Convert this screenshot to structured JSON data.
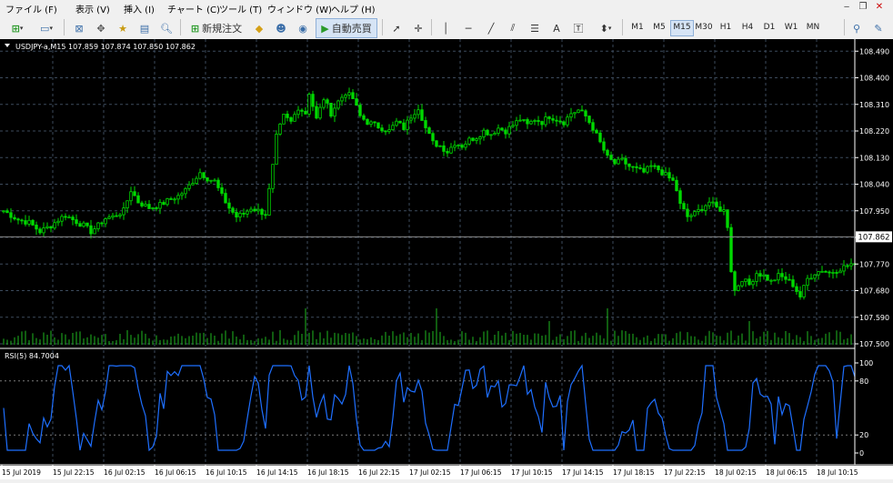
{
  "menu": {
    "items": [
      "ファイル (F)",
      "表示 (V)",
      "挿入 (I)",
      "チャート (C)",
      "ツール (T)",
      "ウィンドウ (W)",
      "ヘルプ (H)"
    ]
  },
  "toolbar": {
    "new_order_label": "新規注文",
    "auto_trade_label": "自動売買",
    "text_tool_label": "A",
    "timeframes": [
      "M1",
      "M5",
      "M15",
      "M30",
      "H1",
      "H4",
      "D1",
      "W1",
      "MN"
    ],
    "active_timeframe": "M15"
  },
  "colors": {
    "background": "#000000",
    "grid": "#3c4a5c",
    "candles": "#00d800",
    "volume": "#1fb81f",
    "rsi_line": "#1e6fff",
    "price_text": "#ffffff"
  },
  "chart_data": [
    {
      "type": "candlestick",
      "title": "USDJPY-a,M15  107.859 107.874 107.850 107.862",
      "current_price_label": "107.862",
      "current_price": 107.862,
      "ylim": [
        107.5,
        108.5
      ],
      "y_ticks": [
        "108.490",
        "108.400",
        "108.310",
        "108.220",
        "108.130",
        "108.040",
        "107.950",
        "107.860",
        "107.770",
        "107.680",
        "107.590",
        "107.500"
      ],
      "y_tick_values": [
        108.49,
        108.4,
        108.31,
        108.22,
        108.13,
        108.04,
        107.95,
        107.86,
        107.77,
        107.68,
        107.59,
        107.5
      ],
      "close_path": [
        [
          0,
          107.95
        ],
        [
          4,
          107.92
        ],
        [
          7,
          107.91
        ],
        [
          10,
          107.88
        ],
        [
          13,
          107.9
        ],
        [
          15,
          107.92
        ],
        [
          17,
          107.935
        ],
        [
          19,
          107.92
        ],
        [
          22,
          107.9
        ],
        [
          24,
          107.88
        ],
        [
          26,
          107.9
        ],
        [
          28,
          107.925
        ],
        [
          30,
          107.93
        ],
        [
          33,
          107.95
        ],
        [
          35,
          108.02
        ],
        [
          37,
          107.98
        ],
        [
          40,
          107.96
        ],
        [
          43,
          107.97
        ],
        [
          46,
          107.99
        ],
        [
          48,
          108.0
        ],
        [
          50,
          108.02
        ],
        [
          52,
          108.05
        ],
        [
          54,
          108.08
        ],
        [
          56,
          108.06
        ],
        [
          58,
          108.05
        ],
        [
          60,
          108.0
        ],
        [
          62,
          107.96
        ],
        [
          64,
          107.93
        ],
        [
          66,
          107.94
        ],
        [
          68,
          107.96
        ],
        [
          70,
          107.95
        ],
        [
          72,
          107.94
        ],
        [
          74,
          108.1
        ],
        [
          75,
          108.2
        ],
        [
          77,
          108.27
        ],
        [
          79,
          108.25
        ],
        [
          81,
          108.3
        ],
        [
          83,
          108.28
        ],
        [
          84,
          108.35
        ],
        [
          86,
          108.26
        ],
        [
          88,
          108.33
        ],
        [
          90,
          108.28
        ],
        [
          92,
          108.32
        ],
        [
          94,
          108.35
        ],
        [
          96,
          108.33
        ],
        [
          98,
          108.27
        ],
        [
          100,
          108.25
        ],
        [
          102,
          108.24
        ],
        [
          104,
          108.23
        ],
        [
          106,
          108.22
        ],
        [
          108,
          108.25
        ],
        [
          110,
          108.23
        ],
        [
          112,
          108.27
        ],
        [
          114,
          108.3
        ],
        [
          116,
          108.23
        ],
        [
          118,
          108.18
        ],
        [
          120,
          108.17
        ],
        [
          122,
          108.15
        ],
        [
          124,
          108.18
        ],
        [
          126,
          108.17
        ],
        [
          128,
          108.19
        ],
        [
          130,
          108.2
        ],
        [
          132,
          108.22
        ],
        [
          134,
          108.21
        ],
        [
          136,
          108.23
        ],
        [
          138,
          108.22
        ],
        [
          140,
          108.24
        ],
        [
          142,
          108.26
        ],
        [
          144,
          108.24
        ],
        [
          146,
          108.26
        ],
        [
          148,
          108.25
        ],
        [
          150,
          108.27
        ],
        [
          152,
          108.26
        ],
        [
          154,
          108.25
        ],
        [
          156,
          108.28
        ],
        [
          158,
          108.29
        ],
        [
          160,
          108.27
        ],
        [
          162,
          108.23
        ],
        [
          164,
          108.18
        ],
        [
          166,
          108.13
        ],
        [
          168,
          108.11
        ],
        [
          170,
          108.12
        ],
        [
          172,
          108.1
        ],
        [
          174,
          108.09
        ],
        [
          176,
          108.08
        ],
        [
          178,
          108.1
        ],
        [
          180,
          108.09
        ],
        [
          182,
          108.07
        ],
        [
          184,
          108.05
        ],
        [
          185,
          108.02
        ],
        [
          186,
          107.97
        ],
        [
          188,
          107.93
        ],
        [
          190,
          107.94
        ],
        [
          192,
          107.96
        ],
        [
          194,
          107.98
        ],
        [
          196,
          107.96
        ],
        [
          198,
          107.95
        ],
        [
          199,
          107.9
        ],
        [
          200,
          107.75
        ],
        [
          201,
          107.68
        ],
        [
          203,
          107.72
        ],
        [
          205,
          107.7
        ],
        [
          207,
          107.74
        ],
        [
          209,
          107.73
        ],
        [
          211,
          107.71
        ],
        [
          213,
          107.73
        ],
        [
          215,
          107.72
        ],
        [
          217,
          107.7
        ],
        [
          219,
          107.66
        ],
        [
          221,
          107.72
        ],
        [
          223,
          107.74
        ],
        [
          225,
          107.75
        ],
        [
          227,
          107.74
        ],
        [
          229,
          107.75
        ],
        [
          231,
          107.76
        ],
        [
          233,
          107.77
        ],
        [
          234,
          107.76
        ]
      ],
      "volume_bars": "tick volume histogram along bottom of price pane"
    },
    {
      "type": "line",
      "title": "RSI(5) 84.7004",
      "ylim": [
        0,
        100
      ],
      "y_ticks": [
        "100",
        "80",
        "20",
        "0"
      ],
      "y_tick_values": [
        100,
        80,
        20,
        0
      ],
      "levels": [
        80,
        20
      ],
      "series": [
        {
          "name": "RSI(5)",
          "color": "#1e6fff"
        }
      ],
      "last_value": 84.7004
    },
    {
      "type": "axis",
      "x_tick_labels": [
        "15 Jul 2019",
        "15 Jul 22:15",
        "16 Jul 02:15",
        "16 Jul 06:15",
        "16 Jul 10:15",
        "16 Jul 14:15",
        "16 Jul 18:15",
        "16 Jul 22:15",
        "17 Jul 02:15",
        "17 Jul 06:15",
        "17 Jul 10:15",
        "17 Jul 14:15",
        "17 Jul 18:15",
        "17 Jul 22:15",
        "18 Jul 02:15",
        "18 Jul 06:15",
        "18 Jul 10:15"
      ]
    }
  ]
}
